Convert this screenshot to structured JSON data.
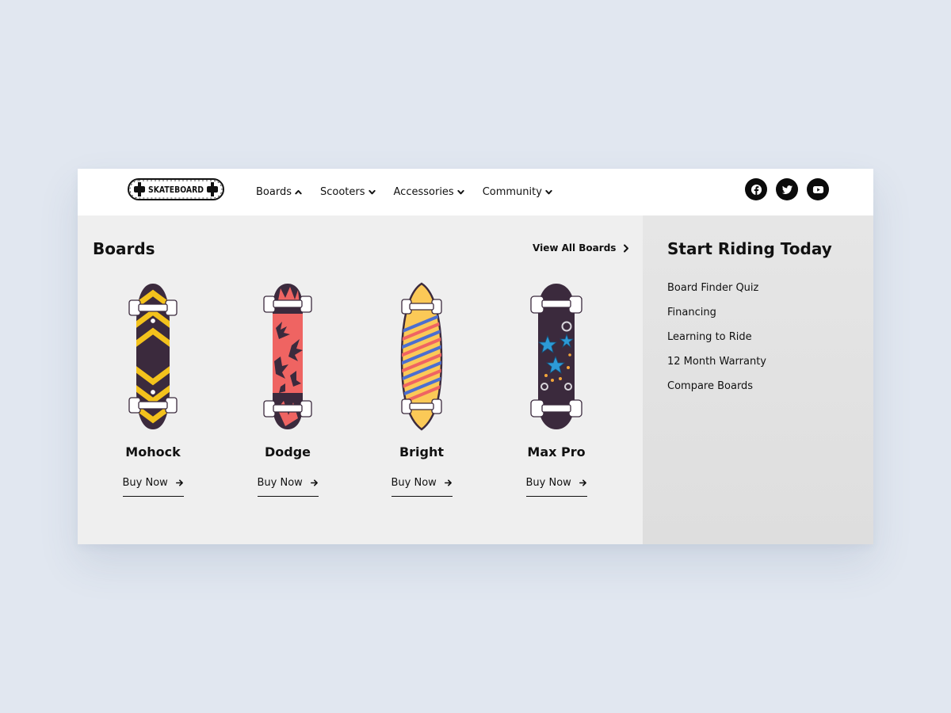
{
  "header": {
    "logo_text": "SKATEBOARD",
    "nav": [
      {
        "label": "Boards",
        "expanded": true
      },
      {
        "label": "Scooters",
        "expanded": false
      },
      {
        "label": "Accessories",
        "expanded": false
      },
      {
        "label": "Community",
        "expanded": false
      }
    ],
    "social": [
      "facebook-icon",
      "twitter-icon",
      "youtube-icon"
    ]
  },
  "boards": {
    "title": "Boards",
    "view_all": "View All Boards",
    "products": [
      {
        "name": "Mohock",
        "cta": "Buy Now"
      },
      {
        "name": "Dodge",
        "cta": "Buy Now"
      },
      {
        "name": "Bright",
        "cta": "Buy Now"
      },
      {
        "name": "Max Pro",
        "cta": "Buy Now"
      }
    ]
  },
  "sidebar": {
    "title": "Start Riding Today",
    "links": [
      "Board Finder Quiz",
      "Financing",
      "Learning to Ride",
      "12 Month Warranty",
      "Compare Boards"
    ]
  },
  "colors": {
    "page_bg": "#e1e7f0",
    "panel_bg": "#efefef",
    "side_bg": "#e2e2e2",
    "board_dark": "#3b2a3d",
    "board_yellow": "#f3c21c",
    "board_coral": "#ef6462",
    "board_bright_bg": "#fbc957",
    "board_stars": "#2d9ad6"
  }
}
